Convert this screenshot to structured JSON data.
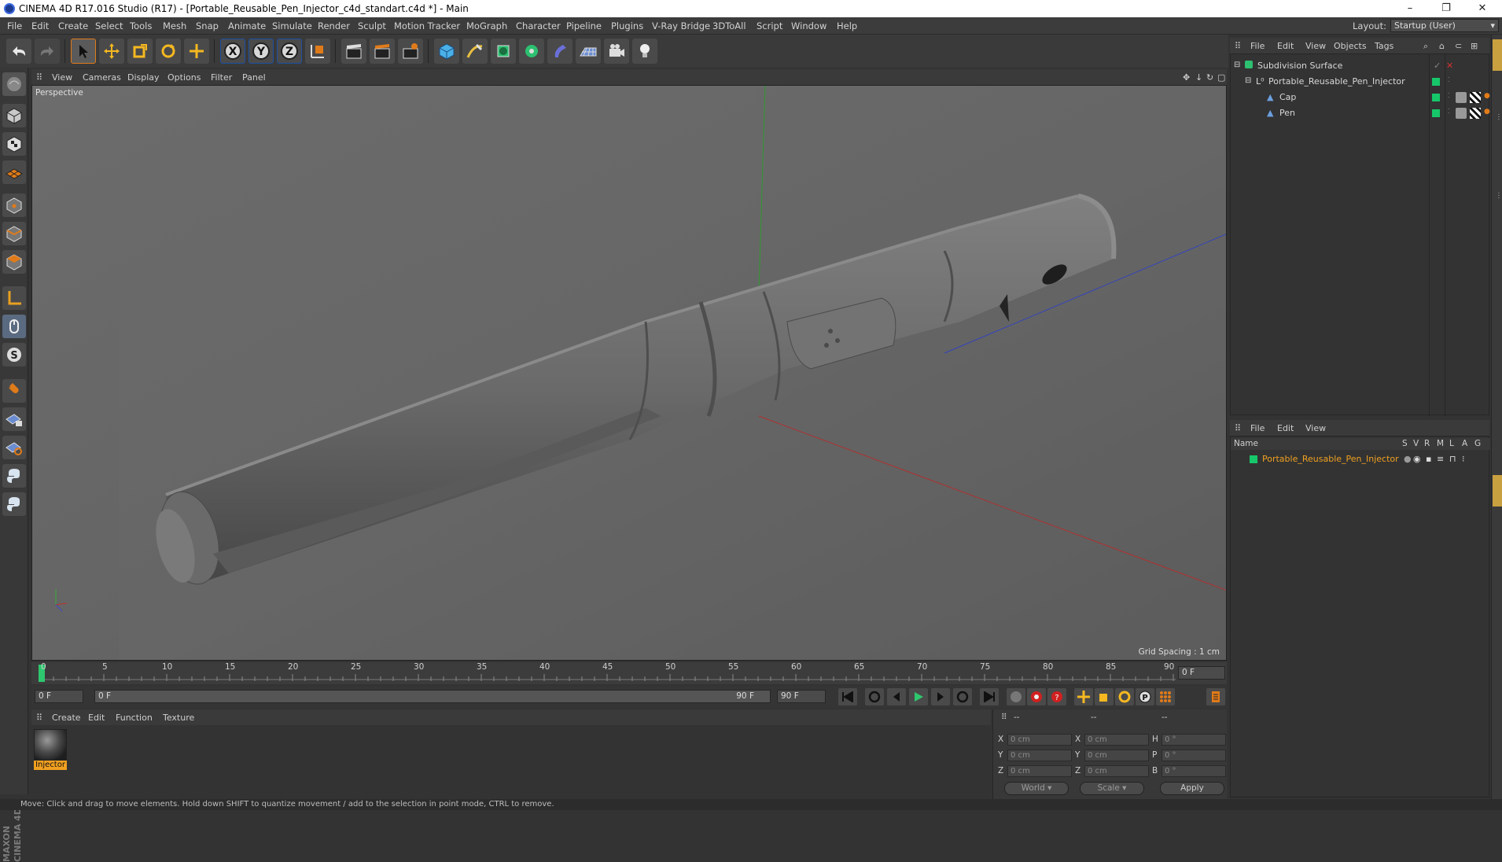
{
  "window": {
    "title": "CINEMA 4D R17.016 Studio (R17) - [Portable_Reusable_Pen_Injector_c4d_standart.c4d *] - Main",
    "minimize": "–",
    "restore": "❐",
    "close": "✕"
  },
  "menu": [
    "File",
    "Edit",
    "Create",
    "Select",
    "Tools",
    "Mesh",
    "Snap",
    "Animate",
    "Simulate",
    "Render",
    "Sculpt",
    "Motion Tracker",
    "MoGraph",
    "Character",
    "Pipeline",
    "Plugins",
    "V-Ray Bridge",
    "3DToAll",
    "Script",
    "Window",
    "Help"
  ],
  "layout": {
    "label": "Layout:",
    "value": "Startup (User)"
  },
  "viewport": {
    "menu": [
      "View",
      "Cameras",
      "Display",
      "Options",
      "Filter",
      "Panel"
    ],
    "label": "Perspective",
    "grid_spacing": "Grid Spacing : 1 cm"
  },
  "timeline": {
    "ticks": [
      "0",
      "5",
      "10",
      "15",
      "20",
      "25",
      "30",
      "35",
      "40",
      "45",
      "50",
      "55",
      "60",
      "65",
      "70",
      "75",
      "80",
      "85",
      "90"
    ],
    "current_frame": "0 F",
    "start": "0 F",
    "range_start": "0 F",
    "range_end": "90 F",
    "end": "90 F"
  },
  "material_manager": {
    "menu": [
      "Create",
      "Edit",
      "Function",
      "Texture"
    ],
    "materials": [
      {
        "name": "Injector"
      }
    ]
  },
  "coordinates": {
    "headers": [
      "--",
      "--",
      "--"
    ],
    "rows": [
      {
        "a": "X",
        "av": "0 cm",
        "b": "X",
        "bv": "0 cm",
        "c": "H",
        "cv": "0 °"
      },
      {
        "a": "Y",
        "av": "0 cm",
        "b": "Y",
        "bv": "0 cm",
        "c": "P",
        "cv": "0 °"
      },
      {
        "a": "Z",
        "av": "0 cm",
        "b": "Z",
        "bv": "0 cm",
        "c": "B",
        "cv": "0 °"
      }
    ],
    "mode1": "World",
    "mode2": "Scale",
    "apply": "Apply"
  },
  "object_manager": {
    "menu": [
      "File",
      "Edit",
      "View",
      "Objects",
      "Tags"
    ],
    "objects": [
      {
        "name": "Subdivision Surface",
        "indent": 0
      },
      {
        "name": "Portable_Reusable_Pen_Injector",
        "indent": 1
      },
      {
        "name": "Cap",
        "indent": 2
      },
      {
        "name": "Pen",
        "indent": 2
      }
    ]
  },
  "attribute_manager": {
    "menu": [
      "File",
      "Edit",
      "View"
    ],
    "columns": {
      "name": "Name",
      "flags": [
        "S",
        "V",
        "R",
        "M",
        "L",
        "A",
        "G"
      ]
    },
    "layer": "Portable_Reusable_Pen_Injector"
  },
  "status": "Move: Click and drag to move elements. Hold down SHIFT to quantize movement / add to the selection in point mode, CTRL to remove.",
  "brand": "MAXON CINEMA 4D",
  "colors": {
    "accent": "#f0a020",
    "layer_green": "#16c86a",
    "axis_x": "#c03030",
    "axis_y": "#30a030",
    "axis_z": "#3040c0"
  }
}
